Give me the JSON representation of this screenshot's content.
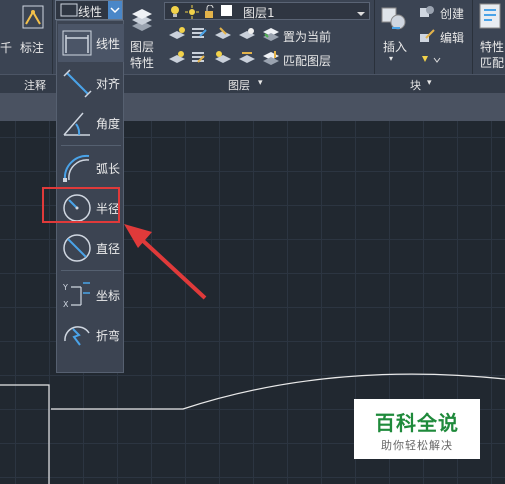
{
  "ribbon": {
    "annotate_label": "标注",
    "panel_annotate": "注释",
    "dim_combo_value": "线性",
    "layer_props": "图层\n特性",
    "layer_combo_value": "图层1",
    "set_current": "置为当前",
    "match_layer": "匹配图层",
    "panel_layers": "图层",
    "insert": "插入",
    "create": "创建",
    "edit": "编辑",
    "panel_block": "块",
    "properties": "特性",
    "match": "匹配"
  },
  "dropdown": {
    "items": [
      {
        "label": "线性",
        "icon": "linear-dim-icon"
      },
      {
        "label": "对齐",
        "icon": "aligned-dim-icon"
      },
      {
        "label": "角度",
        "icon": "angular-dim-icon"
      },
      {
        "label": "弧长",
        "icon": "arc-length-icon"
      },
      {
        "label": "半径",
        "icon": "radius-icon"
      },
      {
        "label": "直径",
        "icon": "diameter-icon"
      },
      {
        "label": "坐标",
        "icon": "ordinate-icon"
      },
      {
        "label": "折弯",
        "icon": "jogged-icon"
      }
    ],
    "highlighted": "半径"
  },
  "watermark": {
    "title": "百科全说",
    "subtitle": "助你轻松解决"
  },
  "colors": {
    "highlight": "#e03a3a",
    "arrow": "#e03a3a",
    "accent": "#4aa3e8"
  }
}
